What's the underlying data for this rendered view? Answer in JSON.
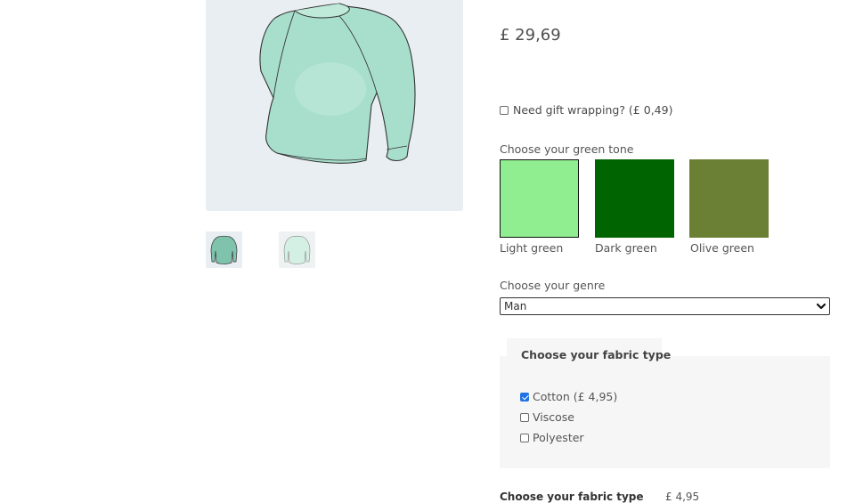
{
  "product": {
    "price": "£ 29,69",
    "image_alt": "Light green long sleeve shirt"
  },
  "gift_wrap": {
    "label": "Need gift wrapping? (£ 0,49)",
    "checked": false
  },
  "color": {
    "heading": "Choose your green tone",
    "options": [
      {
        "label": "Light green",
        "color": "#90ee90",
        "selected": true
      },
      {
        "label": "Dark green",
        "color": "#006400",
        "selected": false
      },
      {
        "label": "Olive green",
        "color": "#6b7f35",
        "selected": false
      }
    ]
  },
  "genre": {
    "heading": "Choose your genre",
    "selected": "Man"
  },
  "fabric": {
    "heading": "Choose your fabric type",
    "options": [
      {
        "label": "Cotton (£ 4,95)",
        "checked": true
      },
      {
        "label": "Viscose",
        "checked": false
      },
      {
        "label": "Polyester",
        "checked": false
      }
    ]
  },
  "summary": {
    "label": "Choose your fabric type",
    "value": "£ 4,95"
  },
  "colors": {
    "image_bg": "#e9eef2",
    "shirt": "#a8dfcc",
    "panel_bg": "#f6f6f6",
    "checkbox_accent": "#1f73e4"
  }
}
